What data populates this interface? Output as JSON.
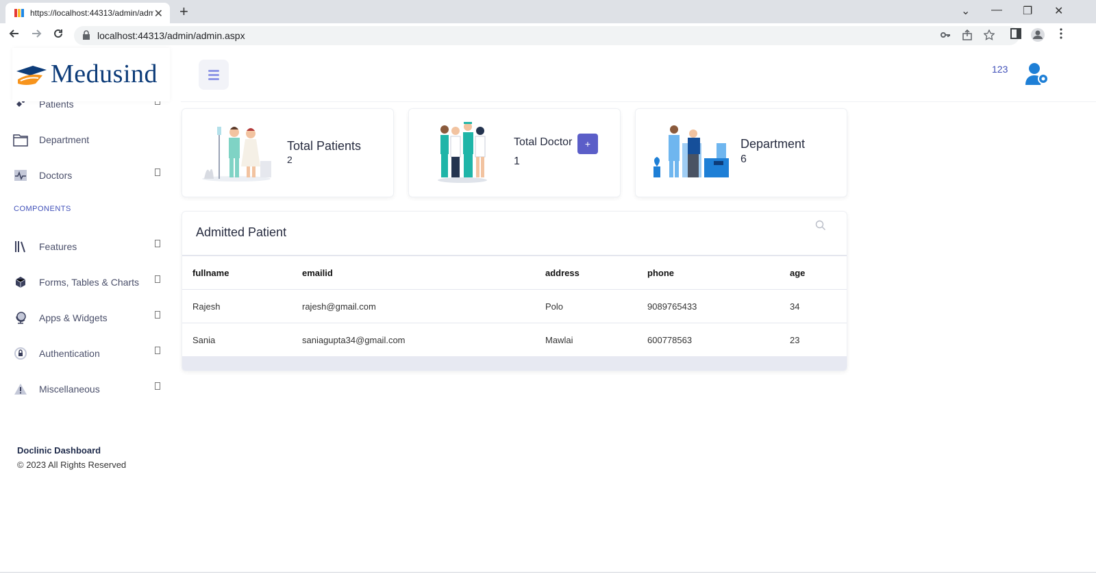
{
  "browser": {
    "tab_title": "https://localhost:44313/admin/admin.aspx",
    "url": "localhost:44313/admin/admin.aspx",
    "new_tab": "+",
    "tab_close": "✕",
    "min": "—",
    "restore": "❐",
    "close": "✕",
    "chevron": "⌄"
  },
  "brand": {
    "name": "Medusind",
    "color": "#0d3c79"
  },
  "sidebar": {
    "items": [
      {
        "label": "Patients"
      },
      {
        "label": "Department"
      },
      {
        "label": "Doctors"
      }
    ],
    "section": "COMPONENTS",
    "components": [
      {
        "label": "Features"
      },
      {
        "label": "Forms, Tables & Charts"
      },
      {
        "label": "Apps & Widgets"
      },
      {
        "label": "Authentication"
      },
      {
        "label": "Miscellaneous"
      }
    ],
    "footer_title": "Doclinic Dashboard",
    "footer_copy": "© 2023 All Rights Reserved"
  },
  "header": {
    "user_number": "123"
  },
  "cards": [
    {
      "title": "Total Patients",
      "value": "2"
    },
    {
      "title": "Total Doctor",
      "value": "1",
      "button": "+"
    },
    {
      "title": "Department",
      "value": "6"
    }
  ],
  "panel": {
    "title": "Admitted Patient",
    "columns": [
      "fullname",
      "emailid",
      "address",
      "phone",
      "age"
    ],
    "rows": [
      [
        "Rajesh",
        "rajesh@gmail.com",
        "Polo",
        "9089765433",
        "34"
      ],
      [
        "Sania",
        "saniagupta34@gmail.com",
        "Mawlai",
        "600778563",
        "23"
      ]
    ]
  },
  "colors": {
    "accent": "#5b5ec8",
    "link": "#3f4fb8"
  }
}
